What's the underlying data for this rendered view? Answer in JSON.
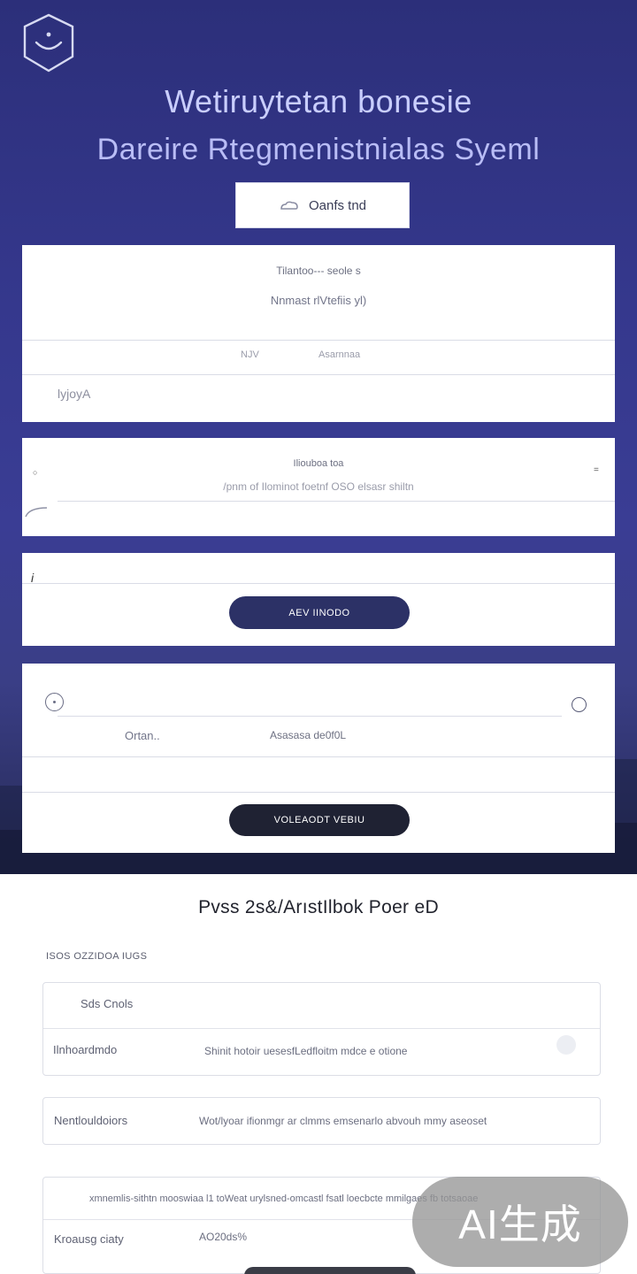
{
  "header": {
    "title_line1": "Wetiruytetan  bonesie",
    "title_line2": "Dareire Rtegmenistnialas Syeml",
    "cta_label": "Oanfs tnd"
  },
  "card_one": {
    "heading": "Tilantoo--- seole s",
    "subtitle": "Nnmast  rlVtefiis yl)",
    "row_left": "NJV",
    "row_right": "Asarnnaa",
    "input_value": "lyjoyA"
  },
  "card_two": {
    "heading": "Iliouboa toa",
    "description": "/pnm of Ilominot foetnf OSO  elsasr shiltn"
  },
  "card_three": {
    "marker": "i",
    "button_label": "AEV IINODO"
  },
  "card_four": {
    "label_left": "Ortan..",
    "label_right": "Asasasa de0f0L",
    "button_label": "VOLEAODT  VEBIU"
  },
  "section": {
    "title": "Pvss 2s&/ArıstIlbok Poer eD",
    "subtitle": "ISOS OZZIDOA IUGS"
  },
  "panel_one": {
    "header": "Sds Cnols",
    "row_label": "Ilnhoardmdo",
    "row_text": "Shinit hotoir uesesfLedfloitm mdce e otione"
  },
  "panel_two": {
    "row_label": "Nentlouldoiors",
    "row_text": "Wot/lyoar ifionmgr ar clmms emsenarlo  abvouh mmy aseoset"
  },
  "panel_three": {
    "row_text": "xmnemlis-sithtn mooswiaa l1 toWeat urylsned-omcastl fsatl loecbcte mmilgaes   fb totsaoae",
    "row_label": "Kroausg ciaty",
    "row_value": "AO20ds%"
  },
  "watermark": "AI生成",
  "colors": {
    "hero_top": "#2c2f7a",
    "hero_bottom": "#262a55",
    "primary_button": "#2c3166",
    "dark_button": "#1f2233"
  },
  "icons": [
    "shield-logo-icon",
    "cloud-icon",
    "radio-icon",
    "chevron-icon"
  ]
}
